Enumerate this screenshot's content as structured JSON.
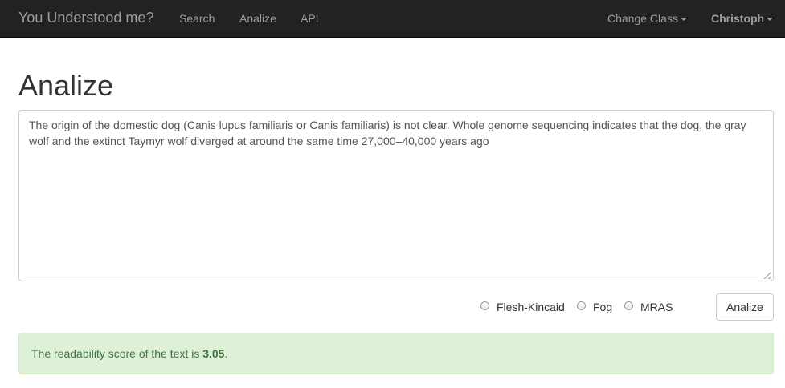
{
  "navbar": {
    "brand": "You Understood me?",
    "links": [
      "Search",
      "Analize",
      "API"
    ],
    "change_class": "Change Class",
    "user": "Christoph"
  },
  "page": {
    "title": "Analize"
  },
  "input": {
    "text": "The origin of the domestic dog (Canis lupus familiaris or Canis familiaris) is not clear. Whole genome sequencing indicates that the dog, the gray wolf and the extinct Taymyr wolf diverged at around the same time 27,000–40,000 years ago"
  },
  "methods": {
    "options": [
      "Flesh-Kincaid",
      "Fog",
      "MRAS"
    ]
  },
  "actions": {
    "analize_label": "Analize"
  },
  "result": {
    "prefix": "The readability score of the text is ",
    "score": "3.05",
    "suffix": "."
  }
}
